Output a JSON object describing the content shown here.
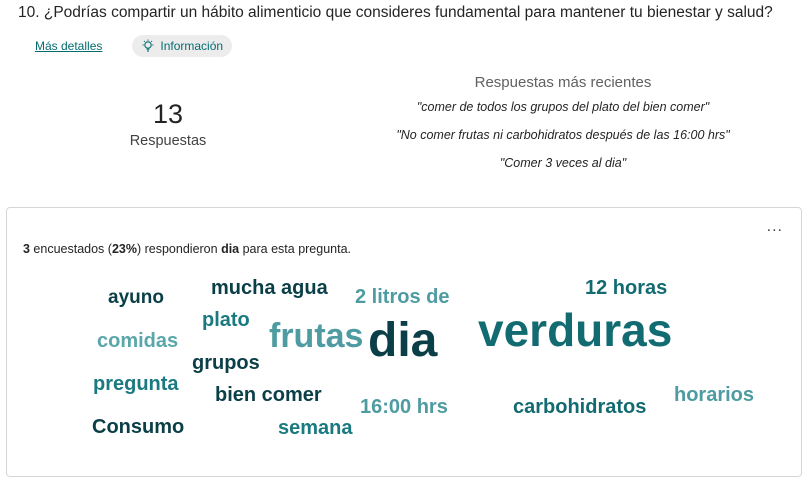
{
  "question": {
    "number": "10.",
    "text": "¿Podrías compartir un hábito alimenticio que consideres fundamental para mantener tu bienestar y salud?"
  },
  "links": {
    "more_details": "Más detalles",
    "info": "Información",
    "info_icon": "lightbulb-icon"
  },
  "responses": {
    "count": "13",
    "label": "Respuestas"
  },
  "recent": {
    "title": "Respuestas más recientes",
    "items": [
      "\"comer de todos los grupos del plato del bien comer\"",
      "\"No comer frutas ni carbohidratos después de las 16:00 hrs\"",
      "\"Comer 3 veces al dia\""
    ]
  },
  "card": {
    "menu": "...",
    "summary": {
      "count": "3",
      "text1": " encuestados (",
      "percent": "23%",
      "text2": ") respondieron ",
      "word": "dia",
      "text3": " para esta pregunta."
    }
  },
  "colors": {
    "accent": "#036c70",
    "dark_teal": "#0b3f47",
    "teal": "#1a7a80",
    "light_teal": "#4e9ca1"
  },
  "word_cloud": {
    "ayuno": "ayuno",
    "mucha_agua": "mucha agua",
    "dos_litros": "2 litros de",
    "doce_horas": "12 horas",
    "plato": "plato",
    "comidas": "comidas",
    "frutas": "frutas",
    "dia": "dia",
    "verduras": "verduras",
    "grupos": "grupos",
    "pregunta": "pregunta",
    "bien_comer": "bien comer",
    "horarios": "horarios",
    "hrs": "16:00 hrs",
    "carbohidratos": "carbohidratos",
    "consumo": "Consumo",
    "semana": "semana"
  }
}
